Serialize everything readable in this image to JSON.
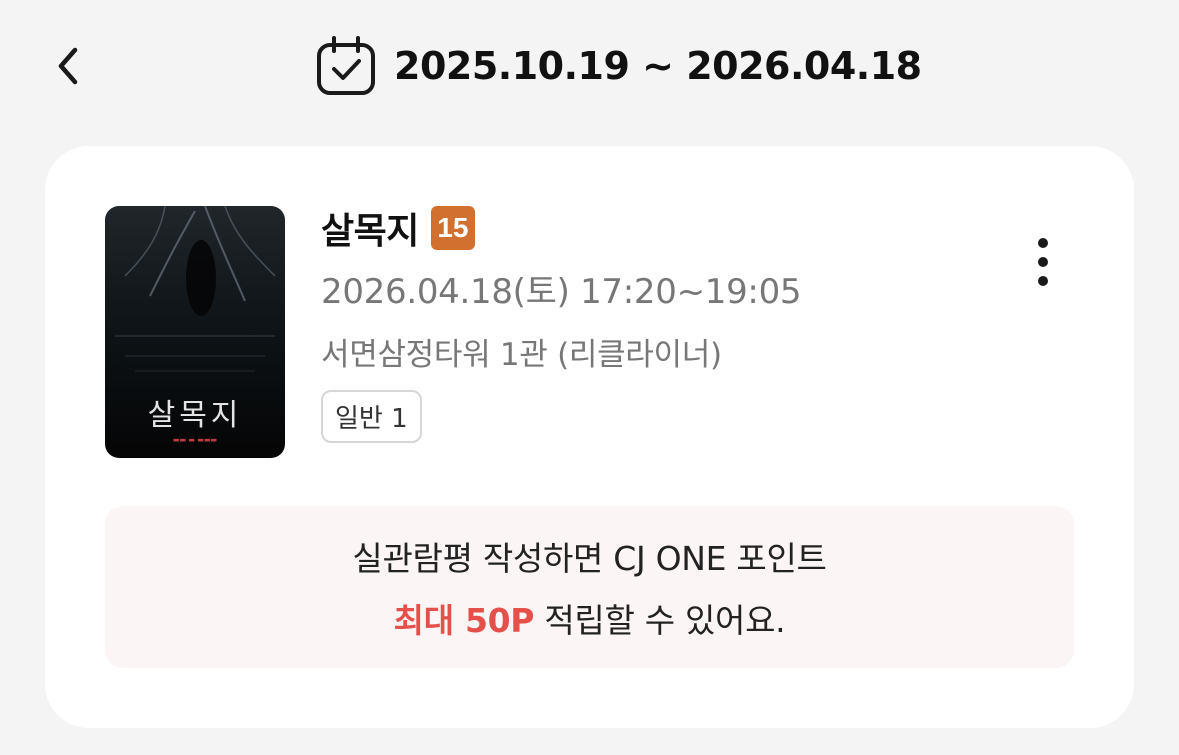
{
  "header": {
    "date_range": "2025.10.19 ~ 2026.04.18"
  },
  "booking": {
    "poster_title": "살목지",
    "movie_title": "살목지",
    "rating": "15",
    "showtime": "2026.04.18(토) 17:20~19:05",
    "theater": "서면삼정타워 1관 (리클라이너)",
    "ticket_type": "일반 1"
  },
  "promo": {
    "line1": "실관람평 작성하면 CJ ONE 포인트",
    "highlight": "최대 50P",
    "line2_rest": " 적립할 수 있어요."
  },
  "colors": {
    "rating_badge": "#d2702f",
    "highlight": "#e5504b",
    "promo_bg": "#fcf5f5",
    "page_bg": "#f4f4f4"
  },
  "icons": {
    "back": "chevron-left-icon",
    "calendar": "calendar-check-icon",
    "more": "more-vertical-icon"
  }
}
